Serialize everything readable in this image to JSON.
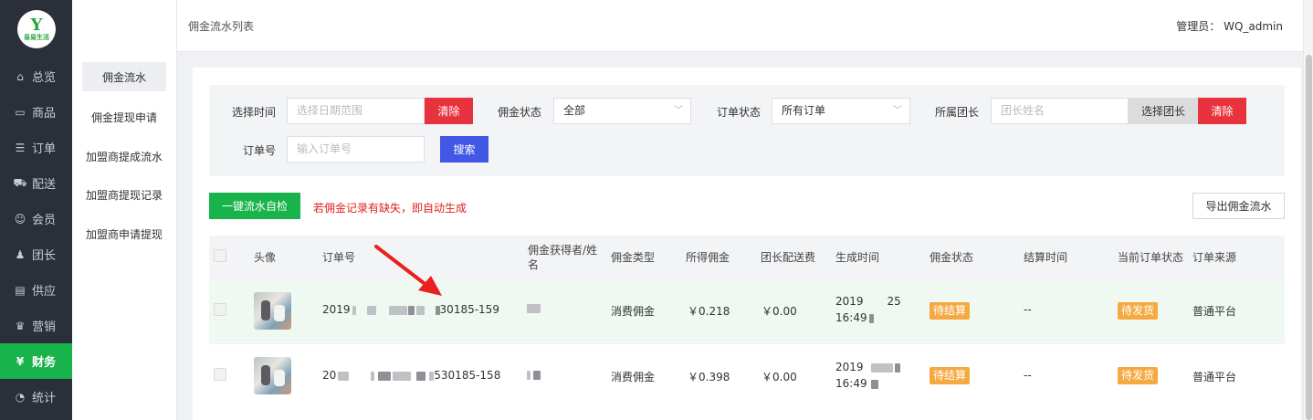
{
  "logo": {
    "mark": "Y",
    "text": "易易生活"
  },
  "nav": [
    {
      "icon": "home-icon",
      "glyph": "⌂",
      "label": "总览"
    },
    {
      "icon": "bag-icon",
      "glyph": "▭",
      "label": "商品"
    },
    {
      "icon": "order-icon",
      "glyph": "☰",
      "label": "订单"
    },
    {
      "icon": "delivery-icon",
      "glyph": "⛟",
      "label": "配送"
    },
    {
      "icon": "user-icon",
      "glyph": "☺",
      "label": "会员"
    },
    {
      "icon": "team-icon",
      "glyph": "♟",
      "label": "团长"
    },
    {
      "icon": "supply-icon",
      "glyph": "▤",
      "label": "供应"
    },
    {
      "icon": "marketing-icon",
      "glyph": "♛",
      "label": "营销"
    },
    {
      "icon": "finance-icon",
      "glyph": "¥",
      "label": "财务"
    },
    {
      "icon": "stats-icon",
      "glyph": "◔",
      "label": "统计"
    }
  ],
  "subnav": [
    "佣金流水",
    "佣金提现申请",
    "加盟商提成流水",
    "加盟商提现记录",
    "加盟商申请提现"
  ],
  "header": {
    "title": "佣金流水列表",
    "admin": "管理员： WQ_admin"
  },
  "filter": {
    "time_label": "选择时间",
    "time_placeholder": "选择日期范围",
    "clear": "清除",
    "status_label": "佣金状态",
    "status_value": "全部",
    "order_status_label": "订单状态",
    "order_status_value": "所有订单",
    "leader_label": "所属团长",
    "leader_placeholder": "团长姓名",
    "choose_leader": "选择团长",
    "order_no_label": "订单号",
    "order_no_placeholder": "输入订单号",
    "search": "搜索"
  },
  "actions": {
    "self_check": "一键流水自检",
    "warning": "若佣金记录有缺失，即自动生成",
    "export": "导出佣金流水"
  },
  "table": {
    "headers": [
      "头像",
      "订单号",
      "佣金获得者/姓名",
      "佣金类型",
      "所得佣金",
      "团长配送费",
      "生成时间",
      "佣金状态",
      "结算时间",
      "当前订单状态",
      "订单来源"
    ],
    "rows": [
      {
        "order_prefix": "2019",
        "order_suffix": "30185-159",
        "type": "消费佣金",
        "commission": "￥0.218",
        "fee": "￥0.00",
        "time1": "2019",
        "time1b": "25",
        "time2": "16:49",
        "status": "待结算",
        "settle": "--",
        "order_status": "待发货",
        "source": "普通平台"
      },
      {
        "order_prefix": "20",
        "order_suffix": "530185-158",
        "type": "消费佣金",
        "commission": "￥0.398",
        "fee": "￥0.00",
        "time1": "2019",
        "time1b": "",
        "time2": "16:49",
        "status": "待结算",
        "settle": "--",
        "order_status": "待发货",
        "source": "普通平台"
      }
    ]
  },
  "colors": {
    "sidebar": "#2a2f3a",
    "active": "#19b34c",
    "danger": "#e8323e",
    "primary": "#4158e6",
    "tag": "#f4a941"
  }
}
